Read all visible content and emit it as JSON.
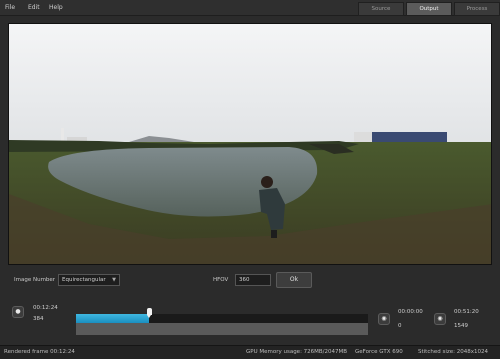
{
  "menu": {
    "file": "File",
    "edit": "Edit",
    "help": "Help"
  },
  "tabs": [
    {
      "label": "Source",
      "active": false
    },
    {
      "label": "Output",
      "active": true
    },
    {
      "label": "Process",
      "active": false
    }
  ],
  "controls": {
    "image_number_label": "Image Number",
    "projection_value": "Equirectangular",
    "hfov_label": "HFOV",
    "hfov_value": "360",
    "ok_label": "Ok"
  },
  "timeline": {
    "current_time": "00:12:24",
    "current_frame": "384",
    "progress_fraction": 0.25,
    "start_time": "00:00:00",
    "start_frame": "0",
    "end_time": "00:51:20",
    "end_frame": "1549"
  },
  "status": {
    "rendered_frame": "Rendered frame 00:12:24",
    "gpu_memory": "GPU Memory usage: 726MB/2047MB",
    "gpu_name": "GeForce GTX 690",
    "stitched_size": "Stitched size: 2048x1024"
  },
  "colors": {
    "accent": "#2aa7d6",
    "background": "#2b2b2b"
  }
}
